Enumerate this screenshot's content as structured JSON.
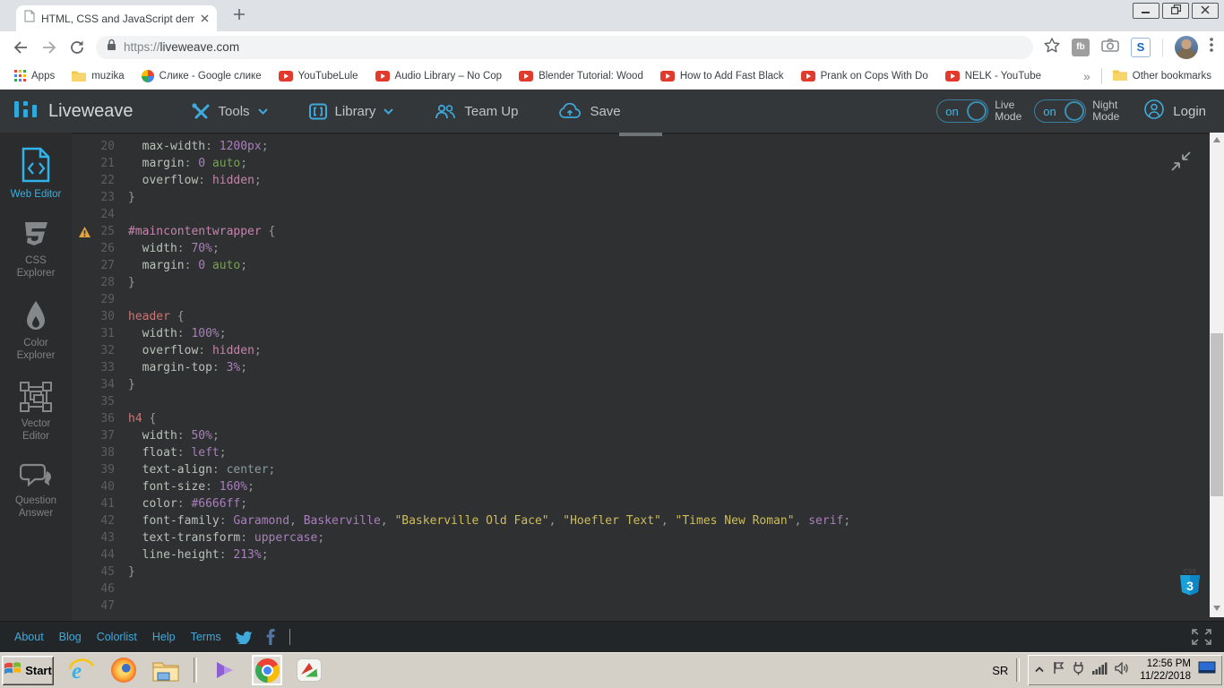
{
  "browser": {
    "tab_title": "HTML, CSS and JavaScript demo - Li",
    "url_scheme": "https://",
    "url_host": "liveweave.com",
    "bookmarks": [
      {
        "label": "Apps",
        "icon": "apps-grid"
      },
      {
        "label": "muzika",
        "icon": "folder"
      },
      {
        "label": "Слике - Google слике",
        "icon": "photos"
      },
      {
        "label": "YouTubeLule",
        "icon": "youtube"
      },
      {
        "label": "Audio Library – No Cop",
        "icon": "youtube"
      },
      {
        "label": "Blender Tutorial: Wood",
        "icon": "youtube"
      },
      {
        "label": "How to Add Fast Black",
        "icon": "youtube"
      },
      {
        "label": "Prank on Cops With Do",
        "icon": "youtube"
      },
      {
        "label": "NELK - YouTube",
        "icon": "youtube"
      }
    ],
    "bookmarks_overflow": "»",
    "other_bookmarks": {
      "label": "Other bookmarks",
      "icon": "folder"
    },
    "extensions": [
      {
        "icon": "fb-badge",
        "label": "fb"
      },
      {
        "icon": "camera",
        "label": ""
      },
      {
        "icon": "s-badge",
        "label": "S"
      }
    ]
  },
  "liveweave": {
    "brand": "Liveweave",
    "menu": [
      {
        "label": "Tools",
        "icon": "tools",
        "chevron": true
      },
      {
        "label": "Library",
        "icon": "library",
        "chevron": true
      },
      {
        "label": "Team Up",
        "icon": "team",
        "chevron": false
      },
      {
        "label": "Save",
        "icon": "save",
        "chevron": false
      }
    ],
    "toggles": [
      {
        "state": "on",
        "line1": "Live",
        "line2": "Mode"
      },
      {
        "state": "on",
        "line1": "Night",
        "line2": "Mode"
      }
    ],
    "login": "Login",
    "sidebar": [
      {
        "label": "Web Editor",
        "icon": "webeditor",
        "active": true
      },
      {
        "label": "CSS Explorer",
        "icon": "css3",
        "active": false
      },
      {
        "label": "Color Explorer",
        "icon": "droplet",
        "active": false
      },
      {
        "label": "Vector Editor",
        "icon": "vector",
        "active": false
      },
      {
        "label": "Question Answer",
        "icon": "chat",
        "active": false
      }
    ],
    "footer_links": [
      "About",
      "Blog",
      "Colorlist",
      "Help",
      "Terms"
    ]
  },
  "editor": {
    "language": "css",
    "lines": [
      {
        "n": 20,
        "warn": false,
        "tokens": [
          [
            "prop",
            "  max-width"
          ],
          [
            "pun",
            ": "
          ],
          [
            "num",
            "1200px"
          ],
          [
            "pun",
            ";"
          ]
        ]
      },
      {
        "n": 21,
        "warn": false,
        "tokens": [
          [
            "prop",
            "  margin"
          ],
          [
            "pun",
            ": "
          ],
          [
            "num",
            "0"
          ],
          [
            "pun",
            " "
          ],
          [
            "green",
            "auto"
          ],
          [
            "pun",
            ";"
          ]
        ]
      },
      {
        "n": 22,
        "warn": false,
        "tokens": [
          [
            "prop",
            "  overflow"
          ],
          [
            "pun",
            ": "
          ],
          [
            "pink",
            "hidden"
          ],
          [
            "pun",
            ";"
          ]
        ]
      },
      {
        "n": 23,
        "warn": false,
        "tokens": [
          [
            "pun",
            "}"
          ]
        ]
      },
      {
        "n": 24,
        "warn": false,
        "tokens": []
      },
      {
        "n": 25,
        "warn": true,
        "tokens": [
          [
            "selp",
            "#maincontentwrapper"
          ],
          [
            "pun",
            " {"
          ]
        ]
      },
      {
        "n": 26,
        "warn": false,
        "tokens": [
          [
            "prop",
            "  width"
          ],
          [
            "pun",
            ": "
          ],
          [
            "num",
            "70%"
          ],
          [
            "pun",
            ";"
          ]
        ]
      },
      {
        "n": 27,
        "warn": false,
        "tokens": [
          [
            "prop",
            "  margin"
          ],
          [
            "pun",
            ": "
          ],
          [
            "num",
            "0"
          ],
          [
            "pun",
            " "
          ],
          [
            "green",
            "auto"
          ],
          [
            "pun",
            ";"
          ]
        ]
      },
      {
        "n": 28,
        "warn": false,
        "tokens": [
          [
            "pun",
            "}"
          ]
        ]
      },
      {
        "n": 29,
        "warn": false,
        "tokens": []
      },
      {
        "n": 30,
        "warn": false,
        "tokens": [
          [
            "selr",
            "header"
          ],
          [
            "pun",
            " {"
          ]
        ]
      },
      {
        "n": 31,
        "warn": false,
        "tokens": [
          [
            "prop",
            "  width"
          ],
          [
            "pun",
            ": "
          ],
          [
            "num",
            "100%"
          ],
          [
            "pun",
            ";"
          ]
        ]
      },
      {
        "n": 32,
        "warn": false,
        "tokens": [
          [
            "prop",
            "  overflow"
          ],
          [
            "pun",
            ": "
          ],
          [
            "pink",
            "hidden"
          ],
          [
            "pun",
            ";"
          ]
        ]
      },
      {
        "n": 33,
        "warn": false,
        "tokens": [
          [
            "prop",
            "  margin-top"
          ],
          [
            "pun",
            ": "
          ],
          [
            "num",
            "3%"
          ],
          [
            "pun",
            ";"
          ]
        ]
      },
      {
        "n": 34,
        "warn": false,
        "tokens": [
          [
            "pun",
            "}"
          ]
        ]
      },
      {
        "n": 35,
        "warn": false,
        "tokens": []
      },
      {
        "n": 36,
        "warn": false,
        "tokens": [
          [
            "selr",
            "h4"
          ],
          [
            "pun",
            " {"
          ]
        ]
      },
      {
        "n": 37,
        "warn": false,
        "tokens": [
          [
            "prop",
            "  width"
          ],
          [
            "pun",
            ": "
          ],
          [
            "num",
            "50%"
          ],
          [
            "pun",
            ";"
          ]
        ]
      },
      {
        "n": 38,
        "warn": false,
        "tokens": [
          [
            "prop",
            "  float"
          ],
          [
            "pun",
            ": "
          ],
          [
            "num",
            "left"
          ],
          [
            "pun",
            ";"
          ]
        ]
      },
      {
        "n": 39,
        "warn": false,
        "tokens": [
          [
            "prop",
            "  text-align"
          ],
          [
            "pun",
            ": "
          ],
          [
            "gray",
            "center"
          ],
          [
            "pun",
            ";"
          ]
        ]
      },
      {
        "n": 40,
        "warn": false,
        "tokens": [
          [
            "prop",
            "  font-size"
          ],
          [
            "pun",
            ": "
          ],
          [
            "num",
            "160%"
          ],
          [
            "pun",
            ";"
          ]
        ]
      },
      {
        "n": 41,
        "warn": false,
        "tokens": [
          [
            "prop",
            "  color"
          ],
          [
            "pun",
            ": "
          ],
          [
            "num",
            "#6666ff"
          ],
          [
            "pun",
            ";"
          ]
        ]
      },
      {
        "n": 42,
        "warn": false,
        "tokens": [
          [
            "prop",
            "  font-family"
          ],
          [
            "pun",
            ": "
          ],
          [
            "num",
            "Garamond"
          ],
          [
            "pun",
            ", "
          ],
          [
            "num",
            "Baskerville"
          ],
          [
            "pun",
            ", "
          ],
          [
            "str",
            "\"Baskerville Old Face\""
          ],
          [
            "pun",
            ", "
          ],
          [
            "str",
            "\"Hoefler Text\""
          ],
          [
            "pun",
            ", "
          ],
          [
            "str",
            "\"Times New Roman\""
          ],
          [
            "pun",
            ", "
          ],
          [
            "num",
            "serif"
          ],
          [
            "pun",
            ";"
          ]
        ]
      },
      {
        "n": 43,
        "warn": false,
        "tokens": [
          [
            "prop",
            "  text-transform"
          ],
          [
            "pun",
            ": "
          ],
          [
            "num",
            "uppercase"
          ],
          [
            "pun",
            ";"
          ]
        ]
      },
      {
        "n": 44,
        "warn": false,
        "tokens": [
          [
            "prop",
            "  line-height"
          ],
          [
            "pun",
            ": "
          ],
          [
            "num",
            "213%"
          ],
          [
            "pun",
            ";"
          ]
        ]
      },
      {
        "n": 45,
        "warn": false,
        "tokens": [
          [
            "pun",
            "}"
          ]
        ]
      },
      {
        "n": 46,
        "warn": false,
        "tokens": []
      },
      {
        "n": 47,
        "warn": false,
        "tokens": []
      }
    ]
  },
  "taskbar": {
    "start_label": "Start",
    "apps": [
      {
        "name": "Internet Explorer",
        "icon": "ie",
        "active": false,
        "divider_after": false
      },
      {
        "name": "Firefox",
        "icon": "firefox",
        "active": false,
        "divider_after": false
      },
      {
        "name": "File Explorer",
        "icon": "explorer",
        "active": false,
        "divider_after": true
      },
      {
        "name": "KMPlayer",
        "icon": "kmplayer",
        "active": false,
        "divider_after": false
      },
      {
        "name": "Chrome",
        "icon": "chrome",
        "active": true,
        "divider_after": false
      },
      {
        "name": "Download Manager",
        "icon": "idm",
        "active": false,
        "divider_after": false
      }
    ],
    "tray": {
      "language": "SR",
      "time": "12:56 PM",
      "date": "11/22/2018"
    }
  },
  "colors": {
    "accent_cyan": "#3fa9dc",
    "editor_bg": "#2e3031",
    "syntax": {
      "prop": "#b9c2b9",
      "pun": "#939b98",
      "num": "#a97fbc",
      "green": "#7aa05a",
      "pink": "#c186a8",
      "selr": "#cb7676",
      "selp": "#c683ae",
      "str": "#cfbd5a",
      "gray": "#8b9b9d"
    }
  }
}
